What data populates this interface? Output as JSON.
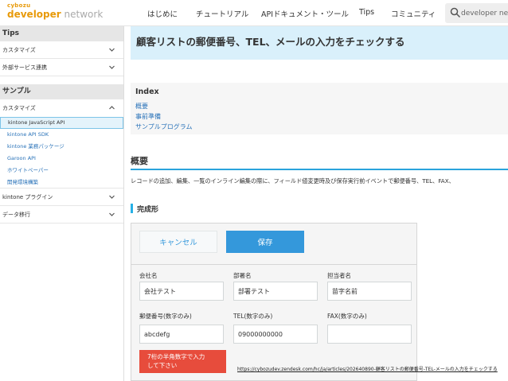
{
  "header": {
    "logo_top": "cybozu",
    "logo_main": "developer",
    "logo_sub": "network",
    "nav": [
      "はじめに",
      "チュートリアル",
      "APIドキュメント・ツール",
      "Tips",
      "コミュニティ"
    ],
    "search_placeholder": "developer netw"
  },
  "sidebar": {
    "tips_section": "Tips",
    "customize": "カスタマイズ",
    "external": "外部サービス連携",
    "sample_section": "サンプル",
    "customize2": "カスタマイズ",
    "sub_items": [
      "kintone JavaScript API",
      "kintone API SDK",
      "kintone 業務パッケージ",
      "Garoon API",
      "ホワイトペーパー",
      "開発環境構築"
    ],
    "plugin": "kintone プラグイン",
    "migration": "データ移行"
  },
  "main": {
    "title": "顧客リストの郵便番号、TEL、メールの入力をチェックする",
    "index_title": "Index",
    "index_links": [
      "概要",
      "事前準備",
      "サンプルプログラム"
    ],
    "overview_heading": "概要",
    "overview_text": "レコードの追加、編集、一覧のインライン編集の際に、フィールド値変更時及び保存実行前イベントで郵便番号、TEL、FAX、",
    "completed_heading": "完成形"
  },
  "form": {
    "cancel_label": "キャンセル",
    "save_label": "保存",
    "labels": [
      "会社名",
      "部署名",
      "担当者名",
      "郵便番号(数字のみ)",
      "TEL(数字のみ)",
      "FAX(数字のみ)"
    ],
    "values": [
      "会社テスト",
      "部署テスト",
      "苗字名前",
      "abcdefg",
      "09000000000",
      ""
    ],
    "error_line1": "7桁の半角数字で入力",
    "error_line2": "して下さい"
  },
  "url_overlay": "https://cybozudev.zendesk.com/hc/ja/articles/202640890-顧客リストの郵便番号-TEL-メールの入力をチェックする",
  "colors": {
    "accent": "#3498db",
    "brand": "#e89a0a",
    "banner": "#d9f0fb",
    "error": "#e74c3c"
  }
}
